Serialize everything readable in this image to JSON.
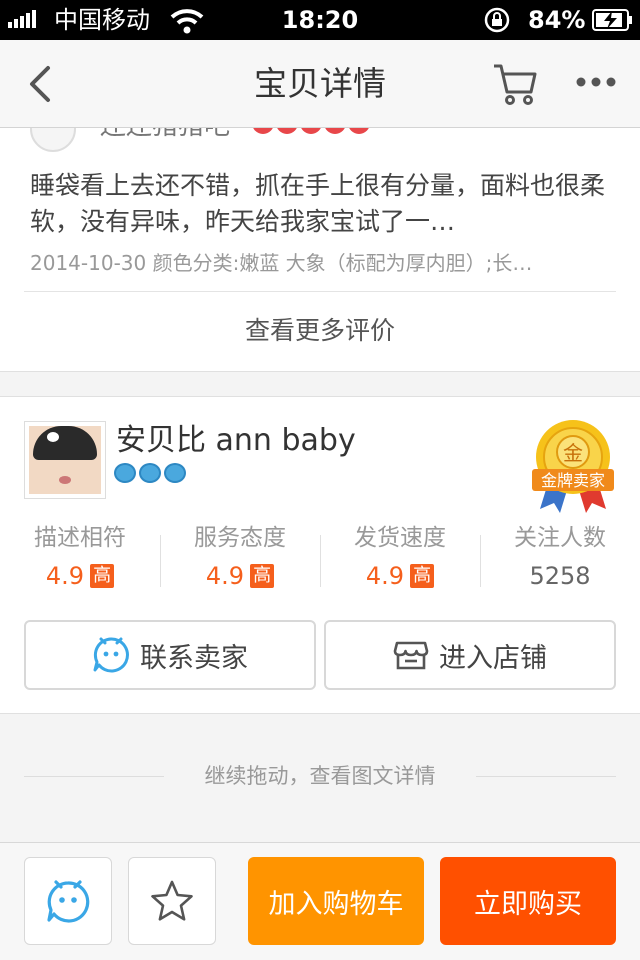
{
  "status_bar": {
    "carrier": "中国移动",
    "time": "18:20",
    "battery": "84%"
  },
  "nav": {
    "title": "宝贝详情"
  },
  "review": {
    "reviewer": "还还猪猪吧",
    "text": "睡袋看上去还不错，抓在手上很有分量，面料也很柔软，没有异味，昨天给我家宝试了一…",
    "meta": "2014-10-30 颜色分类:嫩蓝 大象（标配为厚内胆）;长…",
    "more_label": "查看更多评价"
  },
  "shop": {
    "name": "安贝比 ann baby",
    "medal_char": "金",
    "medal_label": "金牌卖家",
    "stats": [
      {
        "label": "描述相符",
        "value": "4.9",
        "badge": "高"
      },
      {
        "label": "服务态度",
        "value": "4.9",
        "badge": "高"
      },
      {
        "label": "发货速度",
        "value": "4.9",
        "badge": "高"
      },
      {
        "label": "关注人数",
        "value": "5258"
      }
    ],
    "contact_label": "联系卖家",
    "enter_label": "进入店铺"
  },
  "drag_hint": "继续拖动，查看图文详情",
  "bottom": {
    "add_cart": "加入购物车",
    "buy_now": "立即购买"
  },
  "colors": {
    "orange_add": "#ff9400",
    "orange_buy": "#ff5000",
    "accent": "#f55f1c",
    "ww_blue": "#3aa7e6"
  }
}
